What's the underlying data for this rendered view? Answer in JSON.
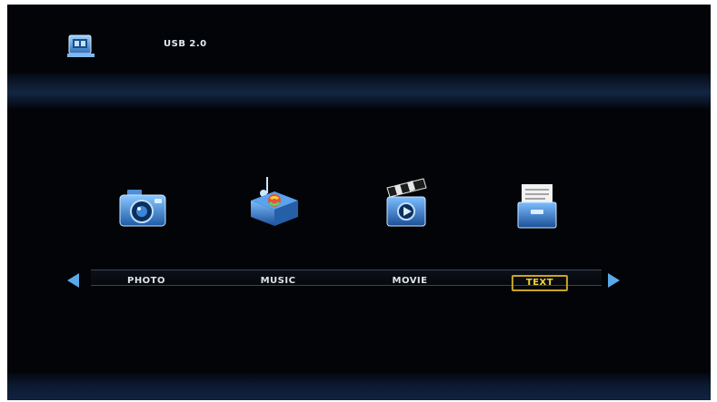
{
  "header": {
    "device_label": "USB 2.0",
    "device_icon": "usb-device-icon"
  },
  "menu": {
    "items": [
      {
        "label": "PHOTO",
        "icon": "camera-icon",
        "selected": false
      },
      {
        "label": "MUSIC",
        "icon": "music-box-icon",
        "selected": false
      },
      {
        "label": "MOVIE",
        "icon": "clapperboard-icon",
        "selected": false
      },
      {
        "label": "TEXT",
        "icon": "document-folder-icon",
        "selected": true
      }
    ],
    "prev_arrow_icon": "arrow-left-icon",
    "next_arrow_icon": "arrow-right-icon"
  },
  "colors": {
    "background": "#020407",
    "accent_blue": "#5aa9e8",
    "selected_text": "#f2d23c",
    "selected_border": "#c8a526",
    "label_text": "#dfe4ea"
  }
}
